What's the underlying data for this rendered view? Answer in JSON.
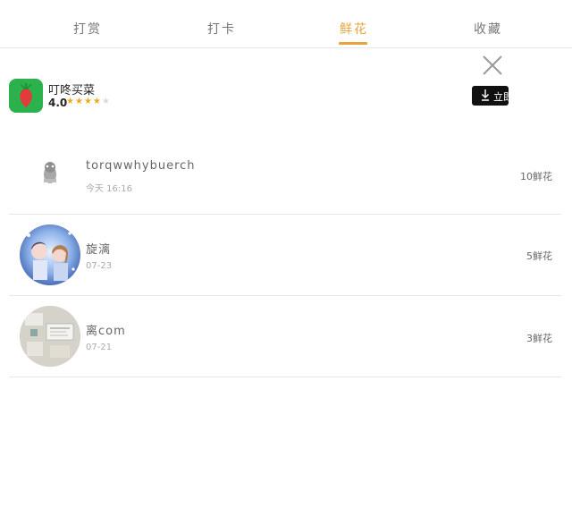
{
  "tabs": [
    {
      "label": "打赏",
      "active": false
    },
    {
      "label": "打卡",
      "active": false
    },
    {
      "label": "鲜花",
      "active": true
    },
    {
      "label": "收藏",
      "active": false
    }
  ],
  "colors": {
    "accent": "#e8a33c",
    "app_icon": "#2bb24c",
    "star": "#f2a81d"
  },
  "ad": {
    "app_name": "叮咚买菜",
    "rating": "4.0",
    "stars_filled": 4,
    "stars_total": 5,
    "download_label": "立即"
  },
  "list": [
    {
      "name": "torqwwhybuerch",
      "date": "今天 16:16",
      "count": "10鲜花"
    },
    {
      "name": "旋漓",
      "date": "07-23",
      "count": "5鲜花"
    },
    {
      "name": "离com",
      "date": "07-21",
      "count": "3鲜花"
    }
  ]
}
